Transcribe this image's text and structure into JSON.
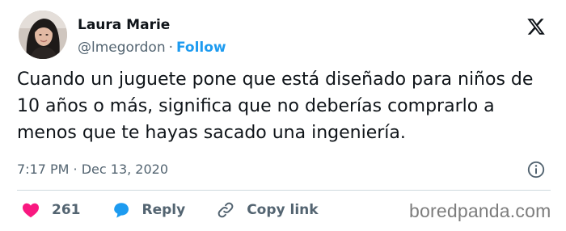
{
  "author": {
    "display_name": "Laura Marie",
    "handle": "@lmegordon",
    "separator": "·",
    "follow_label": "Follow",
    "avatar_icon": "profile-photo"
  },
  "brand": {
    "logo_icon": "x-logo-icon",
    "link_color": "#1d9bf0",
    "like_color": "#f91880"
  },
  "tweet": {
    "text": "Cuando un juguete pone que está diseñado para niños de 10 años o más, significa que no deberías comprarlo a menos que te hayas sacado una ingeniería.",
    "timestamp": "7:17 PM · Dec 13, 2020"
  },
  "actions": {
    "like_count": "261",
    "reply_label": "Reply",
    "copy_link_label": "Copy link"
  },
  "watermark": {
    "text": "boredpanda.com"
  }
}
